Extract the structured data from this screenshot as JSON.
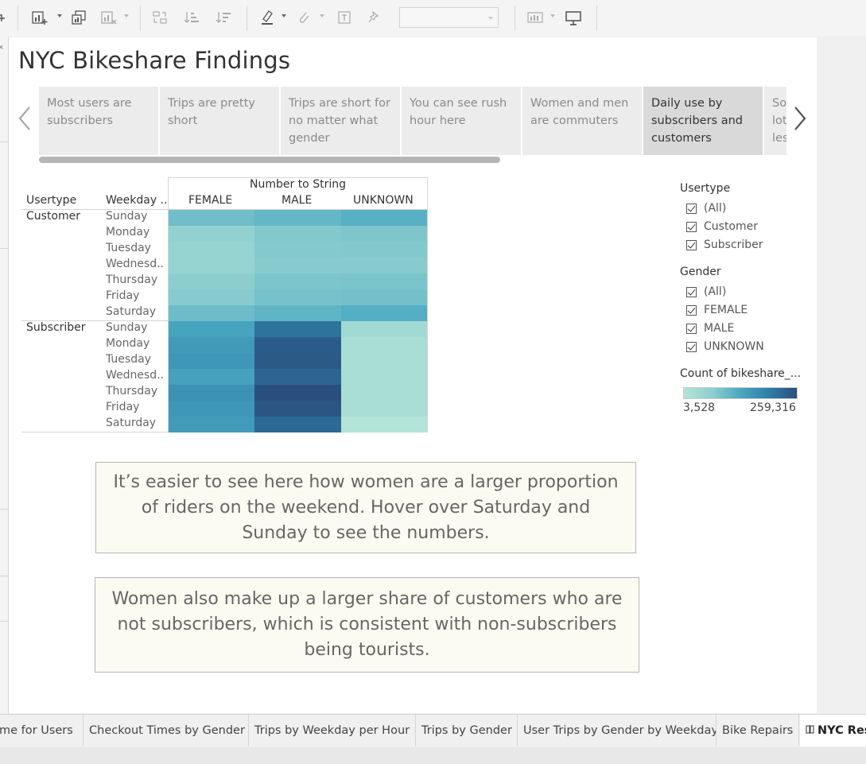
{
  "story": {
    "title": "NYC Bikeshare Findings",
    "points": [
      {
        "label": "Most users are subscribers"
      },
      {
        "label": "Trips are pretty short"
      },
      {
        "label": "Trips are short for no matter what gender"
      },
      {
        "label": "You can see rush hour here"
      },
      {
        "label": "Women and men are commuters"
      },
      {
        "label": "Daily use by subscribers and customers",
        "active": true
      },
      {
        "label": "So lot les"
      }
    ]
  },
  "viz": {
    "column_group_header": "Number to String",
    "row_header_1": "Usertype",
    "row_header_2": "Weekday ..",
    "columns": [
      "FEMALE",
      "MALE",
      "UNKNOWN"
    ],
    "usertypes": [
      "Customer",
      "Subscriber"
    ],
    "weekdays": [
      "Sunday",
      "Monday",
      "Tuesday",
      "Wednesd..",
      "Thursday",
      "Friday",
      "Saturday"
    ]
  },
  "chart_data": {
    "type": "heatmap",
    "title": "",
    "x": [
      "FEMALE",
      "MALE",
      "UNKNOWN"
    ],
    "y_groups": [
      "Customer",
      "Subscriber"
    ],
    "y": [
      "Sunday",
      "Monday",
      "Tuesday",
      "Wednesday",
      "Thursday",
      "Friday",
      "Saturday"
    ],
    "color_range": [
      3528,
      259316
    ],
    "color_scale": [
      "#b4e4d8",
      "#2a4f7e"
    ],
    "values": {
      "Customer": [
        [
          24000,
          32000,
          42000
        ],
        [
          8000,
          14000,
          16000
        ],
        [
          7000,
          13000,
          14000
        ],
        [
          7000,
          12000,
          12000
        ],
        [
          10000,
          17000,
          18000
        ],
        [
          12000,
          20000,
          22000
        ],
        [
          26000,
          36000,
          46000
        ]
      ],
      "Subscriber": [
        [
          62000,
          170000,
          5000
        ],
        [
          82000,
          225000,
          4000
        ],
        [
          88000,
          232000,
          4000
        ],
        [
          68000,
          205000,
          4000
        ],
        [
          100000,
          259316,
          4000
        ],
        [
          88000,
          240000,
          4000
        ],
        [
          80000,
          195000,
          3528
        ]
      ]
    }
  },
  "legends": {
    "usertype": {
      "title": "Usertype",
      "items": [
        "(All)",
        "Customer",
        "Subscriber"
      ]
    },
    "gender": {
      "title": "Gender",
      "items": [
        "(All)",
        "FEMALE",
        "MALE",
        "UNKNOWN"
      ]
    },
    "color": {
      "title": "Count of bikeshare_...",
      "min_label": "3,528",
      "max_label": "259,316"
    }
  },
  "captions": [
    "It’s easier to see here how women are a larger proportion of riders on the weekend. Hover over Saturday and Sunday to see the numbers.",
    "Women also make up a larger share of customers who are not subscribers, which is consistent with non-subscribers being tourists."
  ],
  "tabs": [
    "me for Users",
    "Checkout Times by Gender",
    "Trips by Weekday per Hour",
    "Trips by Gender",
    "User Trips by Gender by Weekday",
    "Bike Repairs",
    "NYC Res"
  ],
  "icons": {
    "toolbar": [
      "new-worksheet-icon",
      "duplicate-icon",
      "clear-sheet-icon",
      "swap-icon",
      "sort-ascending-icon",
      "sort-descending-icon",
      "highlight-icon",
      "group-icon",
      "label-icon",
      "pin-icon",
      "show-me-icon",
      "presentation-icon"
    ],
    "tab_story": "story-icon"
  }
}
